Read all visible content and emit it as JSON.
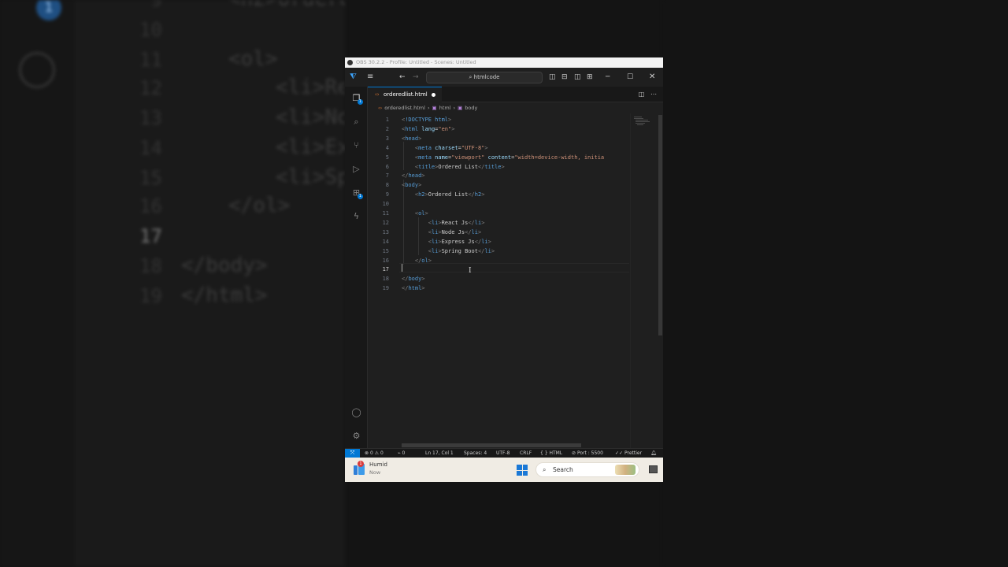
{
  "background": {
    "badge": "1",
    "line_numbers": [
      "9",
      "10",
      "11",
      "12",
      "13",
      "14",
      "15",
      "16",
      "17",
      "18",
      "19"
    ],
    "code": [
      "<h2>Ordere",
      "<ol>",
      "<li>Re",
      "<li>No",
      "<li>Ex",
      "<li>Sp",
      "</ol>",
      "</body>",
      "</html>"
    ]
  },
  "obs_title": "OBS 30.2.2 - Profile: Untitled - Scenes: Untitled",
  "titlebar": {
    "search_label": "htmlcode",
    "menu_icon": "hamburger-icon",
    "back_icon": "arrow-left-icon",
    "forward_icon": "arrow-right-icon"
  },
  "activity_bar": {
    "explorer_badge": "1",
    "extensions_badge": "1"
  },
  "tab": {
    "filename": "orderedlist.html",
    "modified": true
  },
  "breadcrumbs": [
    "orderedlist.html",
    "html",
    "body"
  ],
  "editor": {
    "current_line": 17,
    "lines": [
      "<!DOCTYPE html>",
      "<html lang=\"en\">",
      "<head>",
      "    <meta charset=\"UTF-8\">",
      "    <meta name=\"viewport\" content=\"width=device-width, initia",
      "    <title>Ordered List</title>",
      "</head>",
      "<body>",
      "    <h2>Ordered List</h2>",
      "",
      "    <ol>",
      "        <li>React Js</li>",
      "        <li>Node Js</li>",
      "        <li>Express Js</li>",
      "        <li>Spring Boot</li>",
      "    </ol>",
      "",
      "</body>",
      "</html>"
    ]
  },
  "statusbar": {
    "errors": "0",
    "warnings": "0",
    "ports": "0",
    "position": "Ln 17, Col 1",
    "spaces": "Spaces: 4",
    "encoding": "UTF-8",
    "eol": "CRLF",
    "language": "HTML",
    "port": "Port : 5500",
    "prettier": "Prettier"
  },
  "taskbar": {
    "weather_title": "Humid",
    "weather_sub": "Now",
    "weather_badge": "1",
    "search_label": "Search"
  },
  "colors": {
    "accent": "#0078d4",
    "tag": "#569cd6",
    "attribute": "#9cdcfe",
    "string": "#ce9178",
    "bracket": "#808080"
  }
}
